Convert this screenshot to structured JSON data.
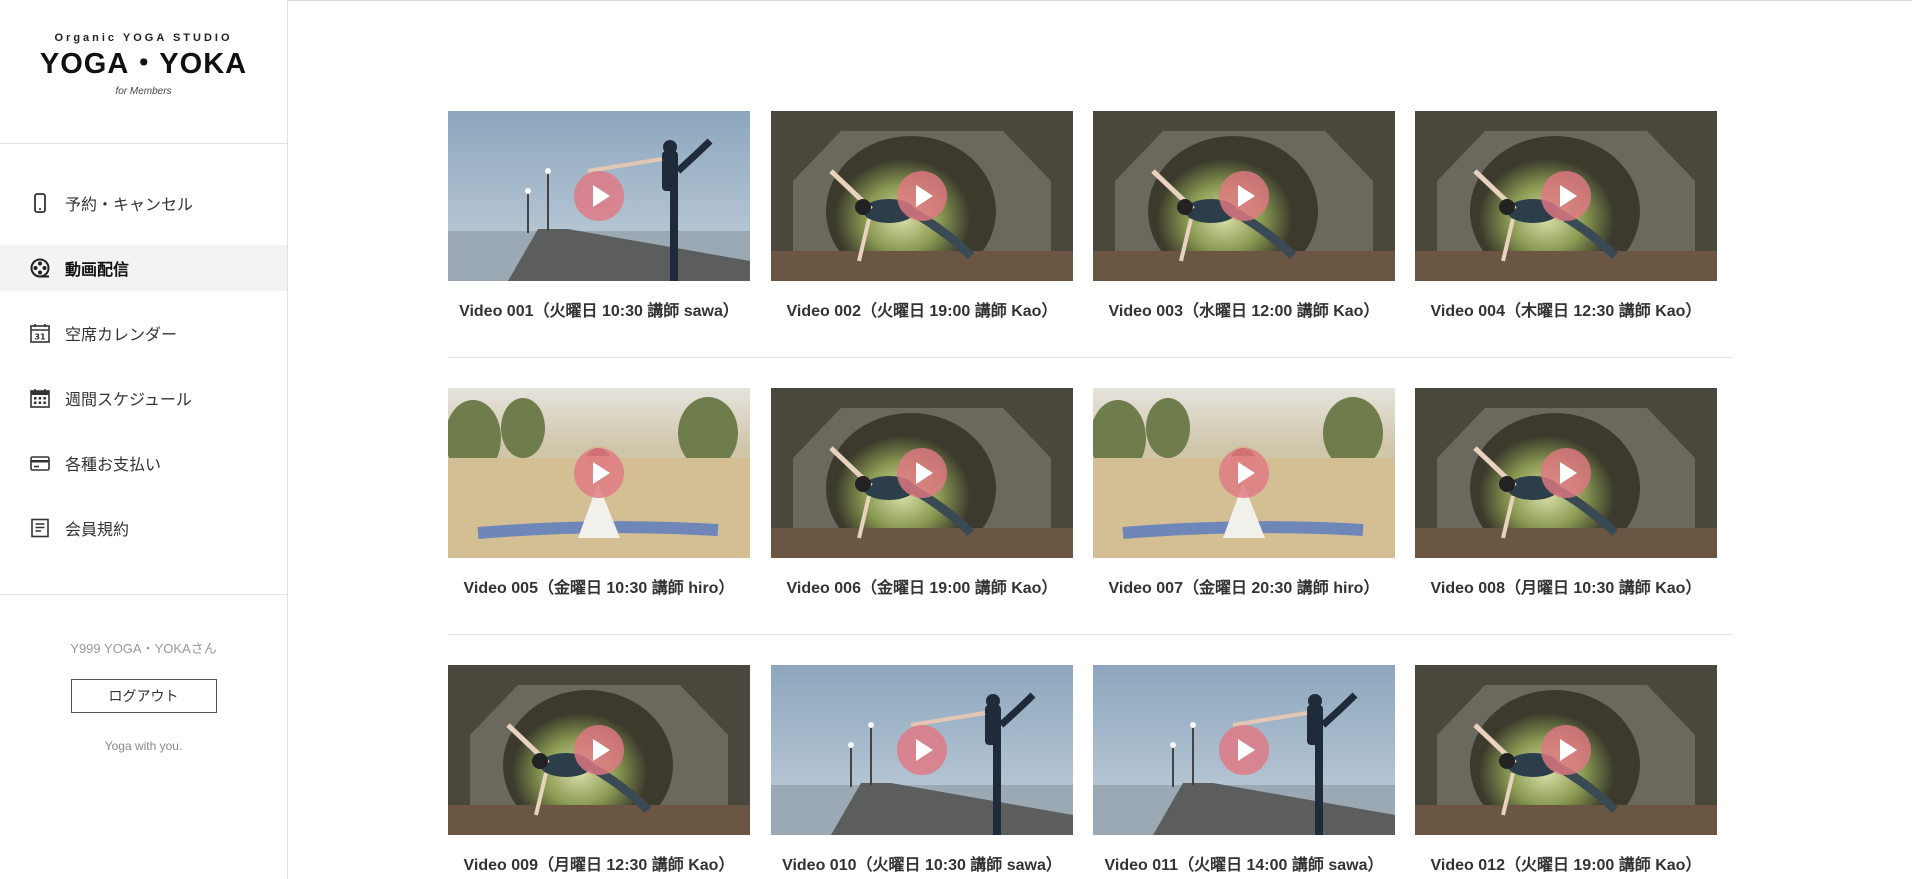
{
  "brand": {
    "small": "Organic YOGA STUDIO",
    "main": "YOGA・YOKA",
    "sub": "for Members"
  },
  "nav": [
    {
      "label": "予約・キャンセル",
      "icon": "phone-icon"
    },
    {
      "label": "動画配信",
      "icon": "film-reel-icon",
      "active": true
    },
    {
      "label": "空席カレンダー",
      "icon": "calendar-31-icon"
    },
    {
      "label": "週間スケジュール",
      "icon": "calendar-grid-icon"
    },
    {
      "label": "各種お支払い",
      "icon": "credit-card-icon"
    },
    {
      "label": "会員規約",
      "icon": "document-icon"
    }
  ],
  "user": {
    "name": "Y999 YOGA・YOKAさん",
    "logout_label": "ログアウト",
    "tagline": "Yoga with you."
  },
  "videos": [
    {
      "title": "Video 001（火曜日 10:30 講師 sawa）",
      "thumb": "pier"
    },
    {
      "title": "Video 002（火曜日 19:00 講師 Kao）",
      "thumb": "tunnel"
    },
    {
      "title": "Video 003（水曜日 12:00 講師 Kao）",
      "thumb": "tunnel"
    },
    {
      "title": "Video 004（木曜日 12:30 講師 Kao）",
      "thumb": "tunnel"
    },
    {
      "title": "Video 005（金曜日 10:30 講師 hiro）",
      "thumb": "field"
    },
    {
      "title": "Video 006（金曜日 19:00 講師 Kao）",
      "thumb": "tunnel"
    },
    {
      "title": "Video 007（金曜日 20:30 講師 hiro）",
      "thumb": "field"
    },
    {
      "title": "Video 008（月曜日 10:30 講師 Kao）",
      "thumb": "tunnel"
    },
    {
      "title": "Video 009（月曜日 12:30 講師 Kao）",
      "thumb": "tunnel"
    },
    {
      "title": "Video 010（火曜日 10:30 講師 sawa）",
      "thumb": "pier"
    },
    {
      "title": "Video 011（火曜日 14:00 講師 sawa）",
      "thumb": "pier"
    },
    {
      "title": "Video 012（火曜日 19:00 講師 Kao）",
      "thumb": "tunnel"
    }
  ],
  "colors": {
    "play_button": "#e07882",
    "active_nav_bg": "#f3f3f3"
  }
}
